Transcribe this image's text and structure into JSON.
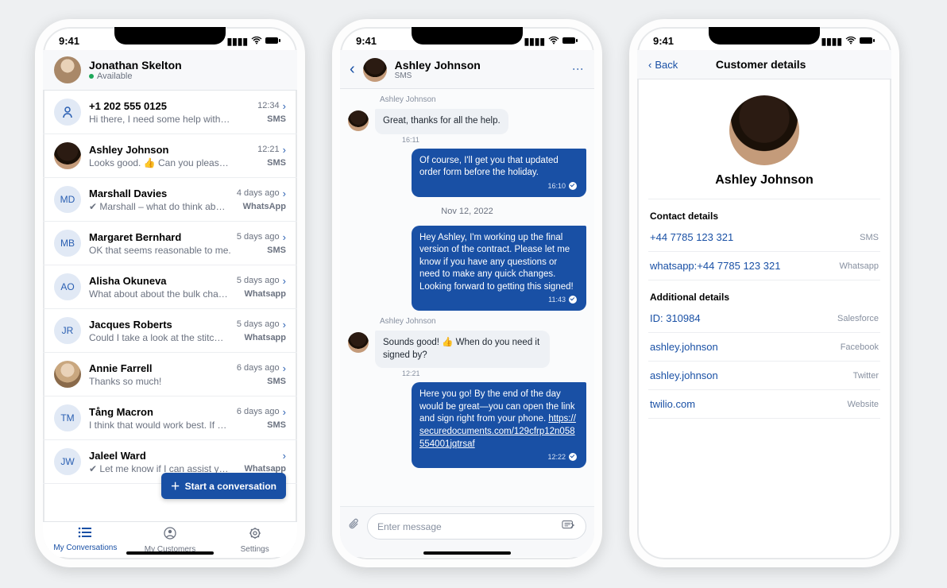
{
  "statusBar": {
    "time": "9:41"
  },
  "phone1": {
    "user": {
      "name": "Jonathan Skelton",
      "presence": "Available"
    },
    "conversations": [
      {
        "avatarType": "anon",
        "initials": "",
        "name": "+1 202 555 0125",
        "time": "12:34",
        "preview": "Hi there, I need some help with my o…",
        "channel": "SMS"
      },
      {
        "avatarType": "photo",
        "initials": "",
        "name": "Ashley Johnson",
        "time": "12:21",
        "preview": "Looks good. 👍 Can you please remin…",
        "channel": "SMS"
      },
      {
        "avatarType": "initials",
        "initials": "MD",
        "name": "Marshall Davies",
        "time": "4 days ago",
        "preview": "✔ Marshall – what do think ab…",
        "channel": "WhatsApp"
      },
      {
        "avatarType": "initials",
        "initials": "MB",
        "name": "Margaret Bernhard",
        "time": "5 days ago",
        "preview": "OK that seems reasonable to me.",
        "channel": "SMS"
      },
      {
        "avatarType": "initials",
        "initials": "AO",
        "name": "Alisha Okuneva",
        "time": "5 days ago",
        "preview": "What about about the bulk cha…",
        "channel": "Whatsapp"
      },
      {
        "avatarType": "initials",
        "initials": "JR",
        "name": "Jacques Roberts",
        "time": "5 days ago",
        "preview": "Could I take a look at the stitc…",
        "channel": "Whatsapp"
      },
      {
        "avatarType": "photo2",
        "initials": "",
        "name": "Annie Farrell",
        "time": "6 days ago",
        "preview": "Thanks so much!",
        "channel": "SMS"
      },
      {
        "avatarType": "initials",
        "initials": "TM",
        "name": "Tång Macron",
        "time": "6 days ago",
        "preview": "I think that would work best. If we co…",
        "channel": "SMS"
      },
      {
        "avatarType": "initials",
        "initials": "JW",
        "name": "Jaleel Ward",
        "time": "",
        "preview": "✔ Let me know if I can assist y…",
        "channel": "Whatsapp"
      }
    ],
    "fab": "Start a conversation",
    "tabs": {
      "t1": "My Conversations",
      "t2": "My Customers",
      "t3": "Settings"
    }
  },
  "phone2": {
    "header": {
      "name": "Ashley Johnson",
      "sub": "SMS"
    },
    "messages": [
      {
        "kind": "sender",
        "text": "Ashley Johnson"
      },
      {
        "kind": "in",
        "text": "Great, thanks for all the help.",
        "ts": "16:11"
      },
      {
        "kind": "out",
        "text": "Of course, I'll get you that updated order form before the holiday.",
        "ts": "16:10"
      },
      {
        "kind": "date",
        "text": "Nov 12, 2022"
      },
      {
        "kind": "out",
        "text": "Hey Ashley, I'm working up the final version of the contract. Please let me know if you have any questions or need to make any quick changes. Looking forward to getting this signed!",
        "ts": "11:43"
      },
      {
        "kind": "sender",
        "text": "Ashley Johnson"
      },
      {
        "kind": "in",
        "text": "Sounds good! 👍 When do you need it signed by?",
        "ts": "12:21"
      },
      {
        "kind": "out",
        "text": "Here you go! By the end of the day would be great—you can open the link and sign right from your phone. ",
        "link": "https://securedocuments.com/129cfrp12n058554001jqtrsaf",
        "ts": "12:22"
      }
    ],
    "composer": {
      "placeholder": "Enter message"
    }
  },
  "phone3": {
    "back": "Back",
    "title": "Customer details",
    "name": "Ashley Johnson",
    "section1": "Contact details",
    "contacts": [
      {
        "val": "+44 7785 123 321",
        "src": "SMS"
      },
      {
        "val": "whatsapp:+44 7785 123 321",
        "src": "Whatsapp"
      }
    ],
    "section2": "Additional details",
    "additional": [
      {
        "val": "ID: 310984",
        "src": "Salesforce"
      },
      {
        "val": "ashley.johnson",
        "src": "Facebook"
      },
      {
        "val": "ashley.johnson",
        "src": "Twitter"
      },
      {
        "val": "twilio.com",
        "src": "Website"
      }
    ]
  }
}
